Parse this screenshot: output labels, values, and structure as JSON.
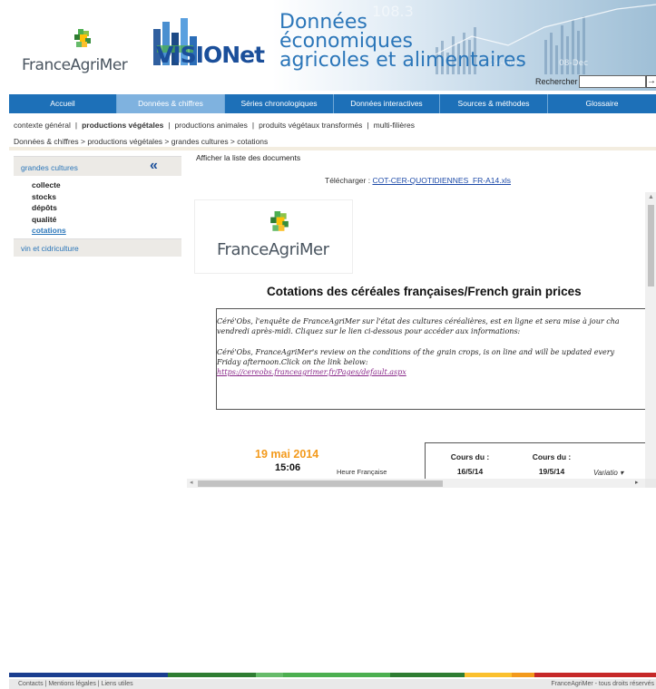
{
  "header": {
    "logo_text": "FranceAgriMer",
    "visio_logo_text": "VISIONet",
    "title_lines": [
      "Données",
      "économiques",
      "agricoles et alimentaires"
    ],
    "search_label": "Rechercher",
    "search_go": "→"
  },
  "nav": {
    "items": [
      "Accueil",
      "Données & chiffres",
      "Séries chronologiques",
      "Données interactives",
      "Sources & méthodes",
      "Glossaire"
    ]
  },
  "subnav": {
    "items": [
      "contexte général",
      "productions végétales",
      "productions animales",
      "produits végétaux transformés",
      "multi-filières"
    ]
  },
  "breadcrumb": "Données & chiffres > productions végétales > grandes cultures > cotations",
  "sidebar": {
    "header": "grandes cultures",
    "collapse_icon": "«",
    "items": [
      "collecte",
      "stocks",
      "dépôts",
      "qualité",
      "cotations"
    ],
    "footer_item": "vin et cidriculture"
  },
  "main": {
    "show_docs": "Afficher la liste des documents",
    "download_label": "Télécharger :",
    "download_file": "COT-CER-QUOTIDIENNES_FR-A14.xls",
    "title": "Cotations des céréales françaises/French grain prices",
    "notice_fr_1": "Céré'Obs, l'enquête de FranceAgriMer sur l'état des cultures céréalières, est en ligne et sera mise à jour cha",
    "notice_fr_2": "vendredi après-midi. Cliquez sur le lien ci-dessous pour accéder aux informations:",
    "notice_en_1": "Céré'Obs, FranceAgriMer's review on the conditions of the grain crops, is on line and will be updated every",
    "notice_en_2": "Friday afternoon.Click on the link below:",
    "notice_link": "https://cereobs.franceagrimer.fr/Pages/default.aspx",
    "date": "19 mai 2014",
    "time": "15:06",
    "time_label": "Heure Française",
    "cours1_label": "Cours du :",
    "cours1_date": "16/5/14",
    "cours2_label": "Cours du :",
    "cours2_date": "19/5/14",
    "variation": "Variatio"
  },
  "footer": {
    "links": "Contacts | Mentions légales | Liens utiles",
    "copyright": "FranceAgriMer - tous droits réservés"
  },
  "colors": {
    "nav_blue": "#1d70b8",
    "accent_orange": "#f39a1c",
    "link_blue": "#2b76b9"
  }
}
